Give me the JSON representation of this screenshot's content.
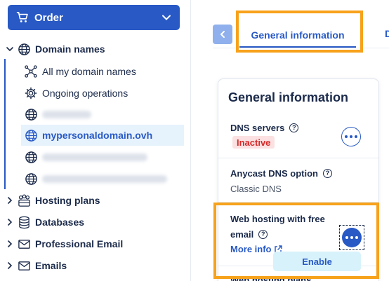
{
  "order_button": {
    "label": "Order"
  },
  "sidebar": {
    "domain_names": "Domain names",
    "all_domains": "All my domain names",
    "ongoing_operations": "Ongoing operations",
    "selected_domain": "mypersonaldomain.ovh",
    "hosting_plans": "Hosting plans",
    "databases": "Databases",
    "professional_email": "Professional Email",
    "emails": "Emails"
  },
  "tabs": {
    "general_information": "General information",
    "next_tab_partial": "D"
  },
  "card": {
    "title": "General information",
    "dns_servers_label": "DNS servers",
    "dns_status": "Inactive",
    "anycast_label": "Anycast DNS option",
    "anycast_value": "Classic DNS",
    "web_hosting_line1": "Web hosting with free",
    "web_hosting_line2": "email",
    "more_info": "More info",
    "enable_button": "Enable",
    "next_section_partial": "Web hosting plans"
  },
  "colors": {
    "accent": "#2859c5",
    "highlight": "#f7a21b",
    "inactive_bg": "#fbe1e1",
    "inactive_text": "#d52b2b",
    "enable_bg": "#d7f2fb"
  },
  "icons": {
    "order": "cart-icon",
    "domain": "globe-icon",
    "all_domains": "network-icon",
    "ongoing": "gear-icon",
    "hosting": "hosting-icon",
    "databases": "database-icon",
    "email": "envelope-icon"
  }
}
